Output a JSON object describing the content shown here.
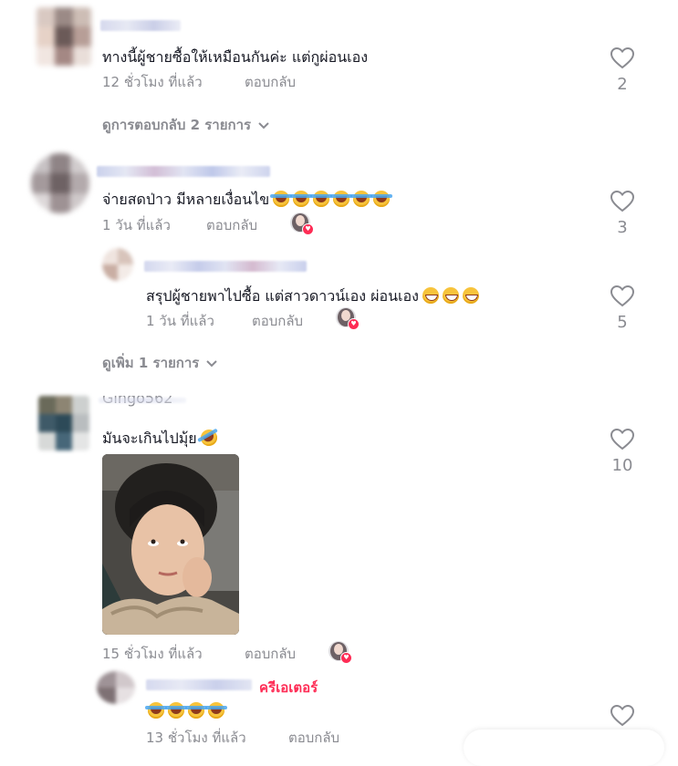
{
  "comments": [
    {
      "text": "ทางนี้ผู้ชายซื้อให้เหมือนกันค่ะ แต่กูผ่อนเอง",
      "time": "12 ชั่วโมง ที่แล้ว",
      "reply_label": "ตอบกลับ",
      "likes": "2",
      "view_replies": "ดูการตอบกลับ 2 รายการ"
    },
    {
      "text": "จ่ายสดป่าว มีหลายเงื่อนไข",
      "emoji_count": 6,
      "time": "1 วัน ที่แล้ว",
      "reply_label": "ตอบกลับ",
      "likes": "3",
      "reply": {
        "text": "สรุปผู้ชายพาไปซื้อ แต่สาวดาวน์เอง ผ่อนเอง",
        "time": "1 วัน ที่แล้ว",
        "reply_label": "ตอบกลับ",
        "likes": "5"
      },
      "view_more": "ดูเพิ่ม 1 รายการ"
    },
    {
      "username_partial": "Gingo562",
      "text": "มันจะเกินไปมุ้ย",
      "time": "15 ชั่วโมง ที่แล้ว",
      "reply_label": "ตอบกลับ",
      "likes": "10",
      "reply": {
        "badge": "ครีเอเตอร์",
        "time": "13 ชั่วโมง ที่แล้ว",
        "reply_label": "ตอบกลับ"
      }
    }
  ],
  "icons": {
    "like": "heart-outline-icon",
    "chevron": "chevron-down-icon"
  },
  "colors": {
    "text": "#161823",
    "meta": "#8a8b91",
    "creator": "#fe2c55"
  }
}
